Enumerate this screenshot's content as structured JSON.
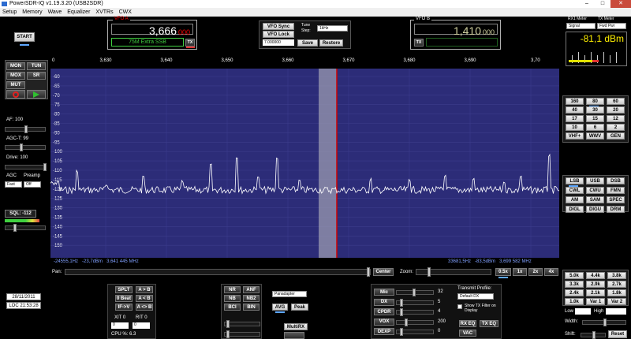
{
  "window": {
    "title": "PowerSDR-IQ v1.19.3.20 (USB2SDR)",
    "min": "–",
    "max": "□",
    "close": "✕"
  },
  "menu": [
    "Setup",
    "Memory",
    "Wave",
    "Equalizer",
    "XVTRs",
    "CWX"
  ],
  "left": {
    "start": "START",
    "mon": "MON",
    "tun": "TUN",
    "mox": "MOX",
    "sr": "SR",
    "mut": "MUT",
    "af_label": "AF:",
    "af": "100",
    "agct_label": "AGC-T:",
    "agct": "99",
    "drive_label": "Drive:",
    "drive": "100",
    "agc_label": "AGC",
    "preamp_label": "Preamp",
    "agc": "Fast",
    "preamp": "Off",
    "sql": "SQL: -112",
    "date": "28/11/2011",
    "time": "LOC 21:53:28"
  },
  "vfoa": {
    "label": "VFO A",
    "freq_main": "3,666",
    "freq_sub": "000",
    "band_info": "75M Extra SSB",
    "tx": "TX"
  },
  "center": {
    "vfo_sync": "VFO Sync",
    "vfo_lock": "VFO Lock",
    "tune_label": "Tune",
    "step_label": "Step:",
    "step": "1kHz",
    "offset": "7.000000",
    "save": "Save",
    "restore": "Restore"
  },
  "vfob": {
    "label": "VFO B",
    "freq_main": "1,410",
    "freq_sub": "000",
    "tx": "TX"
  },
  "meters": {
    "rx1_label": "RX1 Meter",
    "tx_label": "TX Meter",
    "rx1": "Signal",
    "tx": "Fwd Pwr",
    "reading": "-81,1 dBm"
  },
  "spectrum": {
    "freq_ticks": [
      "3,630",
      "3,640",
      "3,650",
      "3,660",
      "3,670",
      "3,680",
      "3,690",
      "3,70"
    ],
    "db_ticks": [
      "-60",
      "-65",
      "-70",
      "-75",
      "-80",
      "-85",
      "-90",
      "-95",
      "-100",
      "-105",
      "-110",
      "-115",
      "-120",
      "-125",
      "-130",
      "-135",
      "-140",
      "-145",
      "-150"
    ],
    "left_readout": "-24555,1Hz",
    "left_dbm": "-23,7dBm",
    "left_mhz": "3,641 445 MHz",
    "right_readout": "33681,5Hz",
    "right_dbm": "-83,5dBm",
    "right_mhz": "3,699 582 MHz"
  },
  "pan": {
    "pan_label": "Pan:",
    "center": "Center",
    "zoom_label": "Zoom:",
    "zooms": [
      "0.5x",
      "1x",
      "2x",
      "4x"
    ]
  },
  "bands": [
    "160",
    "80",
    "60",
    "40",
    "30",
    "20",
    "17",
    "15",
    "12",
    "10",
    "6",
    "2",
    "VHF+",
    "WWV",
    "GEN"
  ],
  "modes": [
    "LSB",
    "USB",
    "DSB",
    "CWL",
    "CWU",
    "FMN",
    "AM",
    "SAM",
    "SPEC",
    "DIGL",
    "DIGU",
    "DRM"
  ],
  "filters": [
    "5.0k",
    "4.4k",
    "3.8k",
    "3.3k",
    "2.9k",
    "2.7k",
    "2.4k",
    "2.1k",
    "1.8k",
    "1.0k",
    "Var 1",
    "Var 2"
  ],
  "filter_ctrl": {
    "low": "Low",
    "high": "High",
    "width": "Width:",
    "shift": "Shift:",
    "reset": "Reset"
  },
  "bottom": {
    "split": "SPLT",
    "ab1": "A > B",
    "beat": "0 Beat",
    "ab2": "A < B",
    "ifv": "IF->V",
    "ab3": "A <> B",
    "xit_label": "XIT",
    "xit": "0",
    "rit_label": "RIT",
    "rit": "0",
    "cpu": "CPU %: 6.3",
    "nr": "NR",
    "anf": "ANF",
    "nb": "NB",
    "nb2": "NB2",
    "bci": "BCI",
    "bin": "BIN",
    "display_mode": "Panadapter",
    "avg": "AVG",
    "peak": "Peak",
    "multirx": "MultiRX",
    "mic": "Mic",
    "dx": "DX",
    "cpdr": "CPDR",
    "vox": "VOX",
    "dexp": "DEXP",
    "mic_val": "32",
    "dx_val": "5",
    "cpdr_val": "4",
    "vox_val": "200",
    "dexp_val": "0",
    "tx_profile_label": "Transmit Profile:",
    "tx_profile": "Default DX",
    "show_filter": "Show TX Filter on Display",
    "rxeq": "RX EQ",
    "txeq": "TX EQ",
    "vac": "VAC"
  },
  "colors": {
    "spectrum_bg": "#2c2c78",
    "filter_band": "#9a9ab0",
    "cursor": "#d00000",
    "trace": "#ffffff",
    "led": "#5fa8ff"
  }
}
